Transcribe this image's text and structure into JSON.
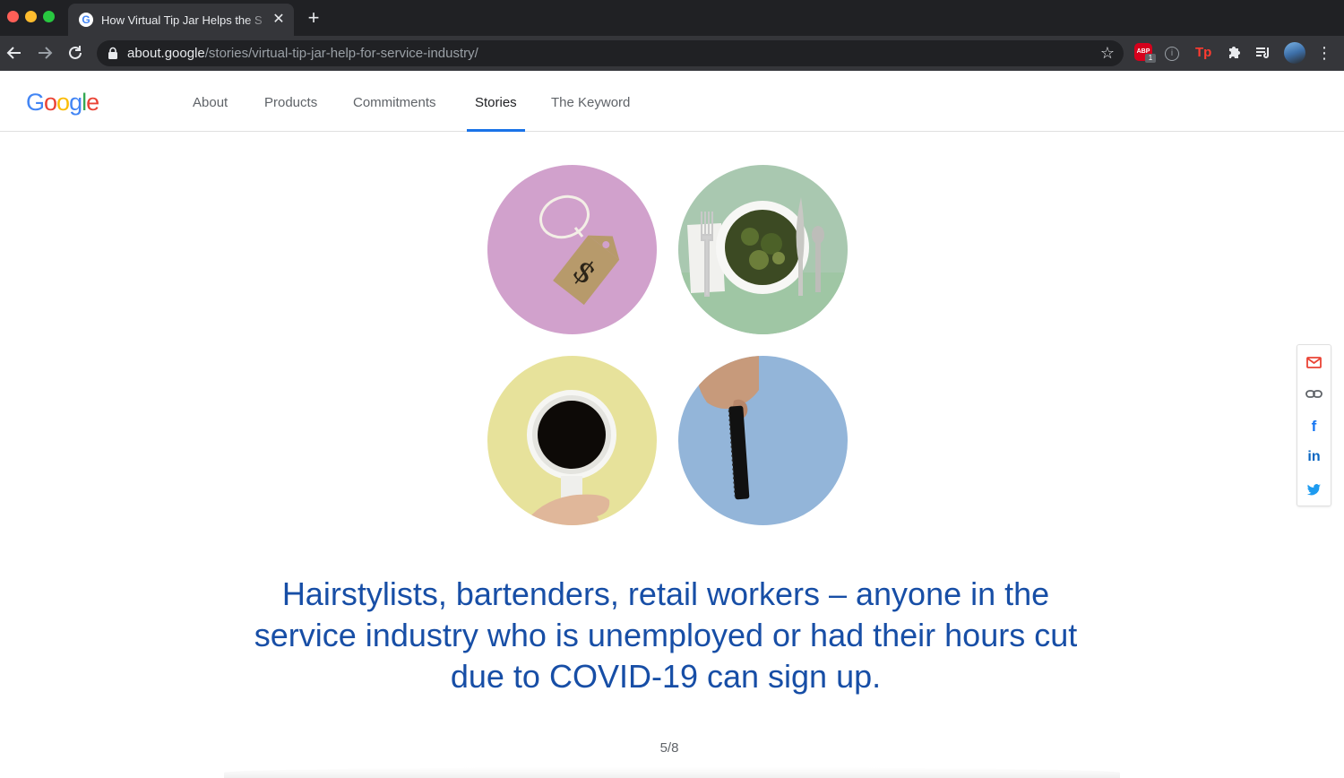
{
  "browser": {
    "tab_title": "How Virtual Tip Jar Helps the S",
    "tab_favicon": "G",
    "tab_close": "✕",
    "new_tab": "+",
    "url_host": "about.google",
    "url_path": "/stories/virtual-tip-jar-help-for-service-industry/",
    "extensions": {
      "abp_label": "ABP",
      "abp_badge": "1",
      "tp_label": "Tp"
    },
    "icons": [
      "back-arrow-icon",
      "forward-arrow-icon",
      "reload-icon",
      "lock-icon",
      "star-icon",
      "adblock-plus-icon",
      "info-icon",
      "tp-extension-icon",
      "puzzle-icon",
      "media-control-icon",
      "profile-avatar",
      "kebab-menu-icon"
    ]
  },
  "site": {
    "logo": {
      "g1": "G",
      "o1": "o",
      "o2": "o",
      "g2": "g",
      "l": "l",
      "e": "e"
    },
    "nav": [
      {
        "label": "About",
        "active": false
      },
      {
        "label": "Products",
        "active": false
      },
      {
        "label": "Commitments",
        "active": false
      },
      {
        "label": "Stories",
        "active": true
      },
      {
        "label": "The Keyword",
        "active": false
      }
    ],
    "accent_color": "#1a73e8"
  },
  "main": {
    "images": [
      "price-tag-image",
      "salad-bowl-image",
      "coffee-cup-image",
      "comb-hand-image"
    ],
    "headline": "Hairstylists, bartenders, retail workers – anyone in the service industry who is unemployed or had their hours cut due to COVID-19 can sign up.",
    "headline_color": "#174ea6",
    "slide_counter": "5/8"
  },
  "share": {
    "icons": [
      "email-icon",
      "link-icon",
      "facebook-icon",
      "linkedin-icon",
      "twitter-icon"
    ],
    "facebook_glyph": "f",
    "linkedin_glyph": "in"
  }
}
